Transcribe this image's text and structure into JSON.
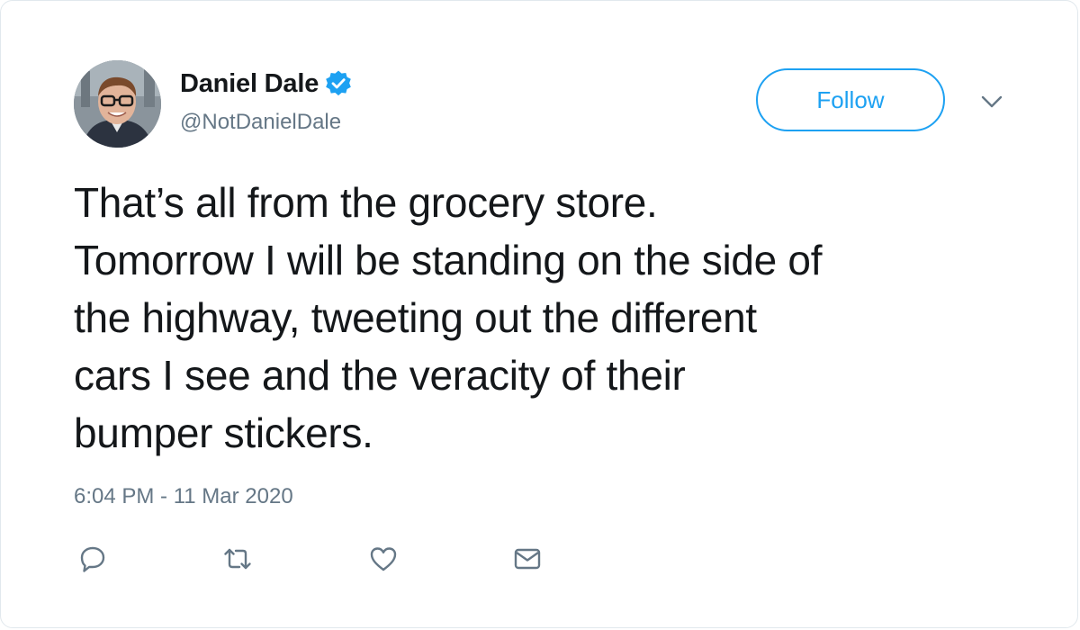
{
  "tweet": {
    "author": {
      "display_name": "Daniel Dale",
      "handle": "@NotDanielDale",
      "verified": true,
      "avatar_icon": "user-photo"
    },
    "follow_label": "Follow",
    "text_lines": [
      "That’s all from the grocery store.",
      "Tomorrow I will be standing on the side of",
      "the highway, tweeting out the different",
      "cars I see and the veracity of their",
      "bumper stickers."
    ],
    "timestamp": "6:04 PM - 11 Mar 2020",
    "actions": [
      {
        "icon": "reply-icon"
      },
      {
        "icon": "retweet-icon"
      },
      {
        "icon": "like-icon"
      },
      {
        "icon": "direct-message-icon"
      }
    ]
  },
  "colors": {
    "accent": "#1da1f2",
    "text": "#14171a",
    "muted": "#657786",
    "border": "#e1e8ed"
  }
}
